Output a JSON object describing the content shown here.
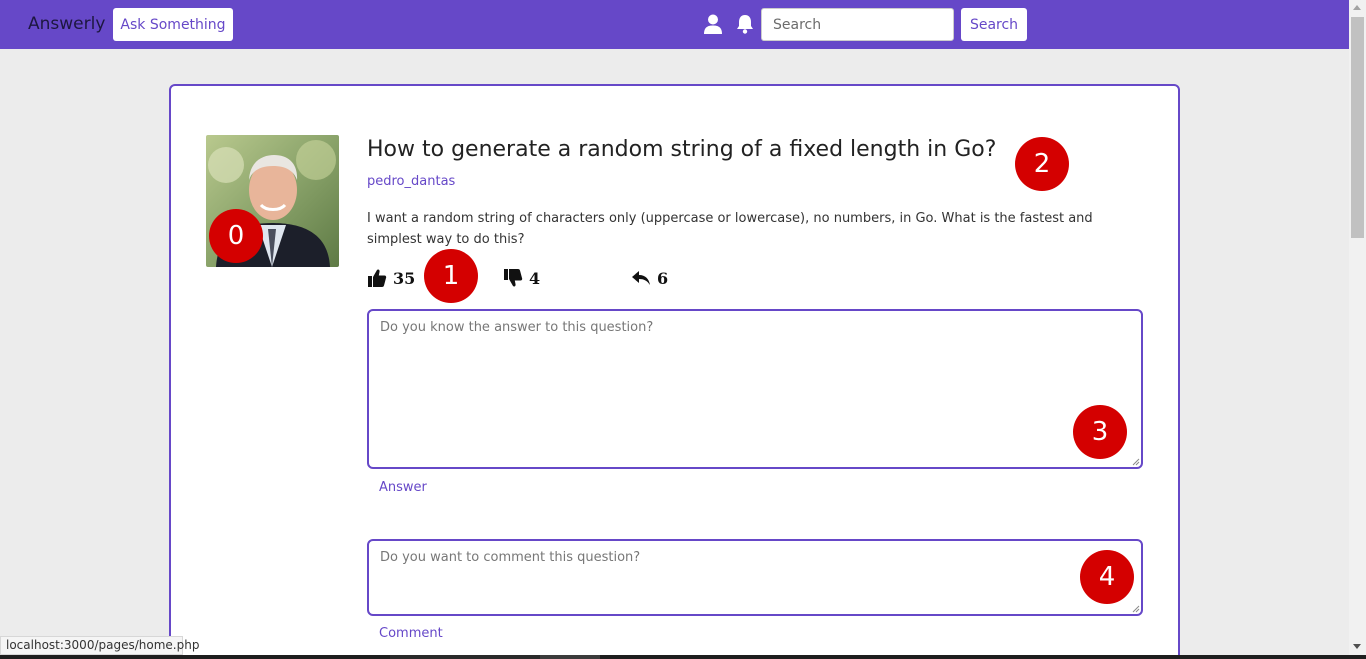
{
  "navbar": {
    "brand": "Answerly",
    "ask_label": "Ask Something",
    "search_placeholder": "Search",
    "search_label": "Search",
    "icons": [
      "user-icon",
      "bell-icon"
    ]
  },
  "question": {
    "title": "How to generate a random string of a fixed length in Go?",
    "author": "pedro_dantas",
    "body": "I want a random string of characters only (uppercase or lowercase), no numbers, in Go. What is the fastest and simplest way to do this?",
    "upvotes": "35",
    "downvotes": "4",
    "replies": "6"
  },
  "answer": {
    "placeholder": "Do you know the answer to this question?",
    "link": "Answer"
  },
  "comment": {
    "placeholder": "Do you want to comment this question?",
    "link": "Comment"
  },
  "markers": [
    "0",
    "1",
    "2",
    "3",
    "4"
  ],
  "status_url": "localhost:3000/pages/home.php",
  "colors": {
    "accent": "#6648c8",
    "marker": "#d40000",
    "background": "#ececec"
  }
}
